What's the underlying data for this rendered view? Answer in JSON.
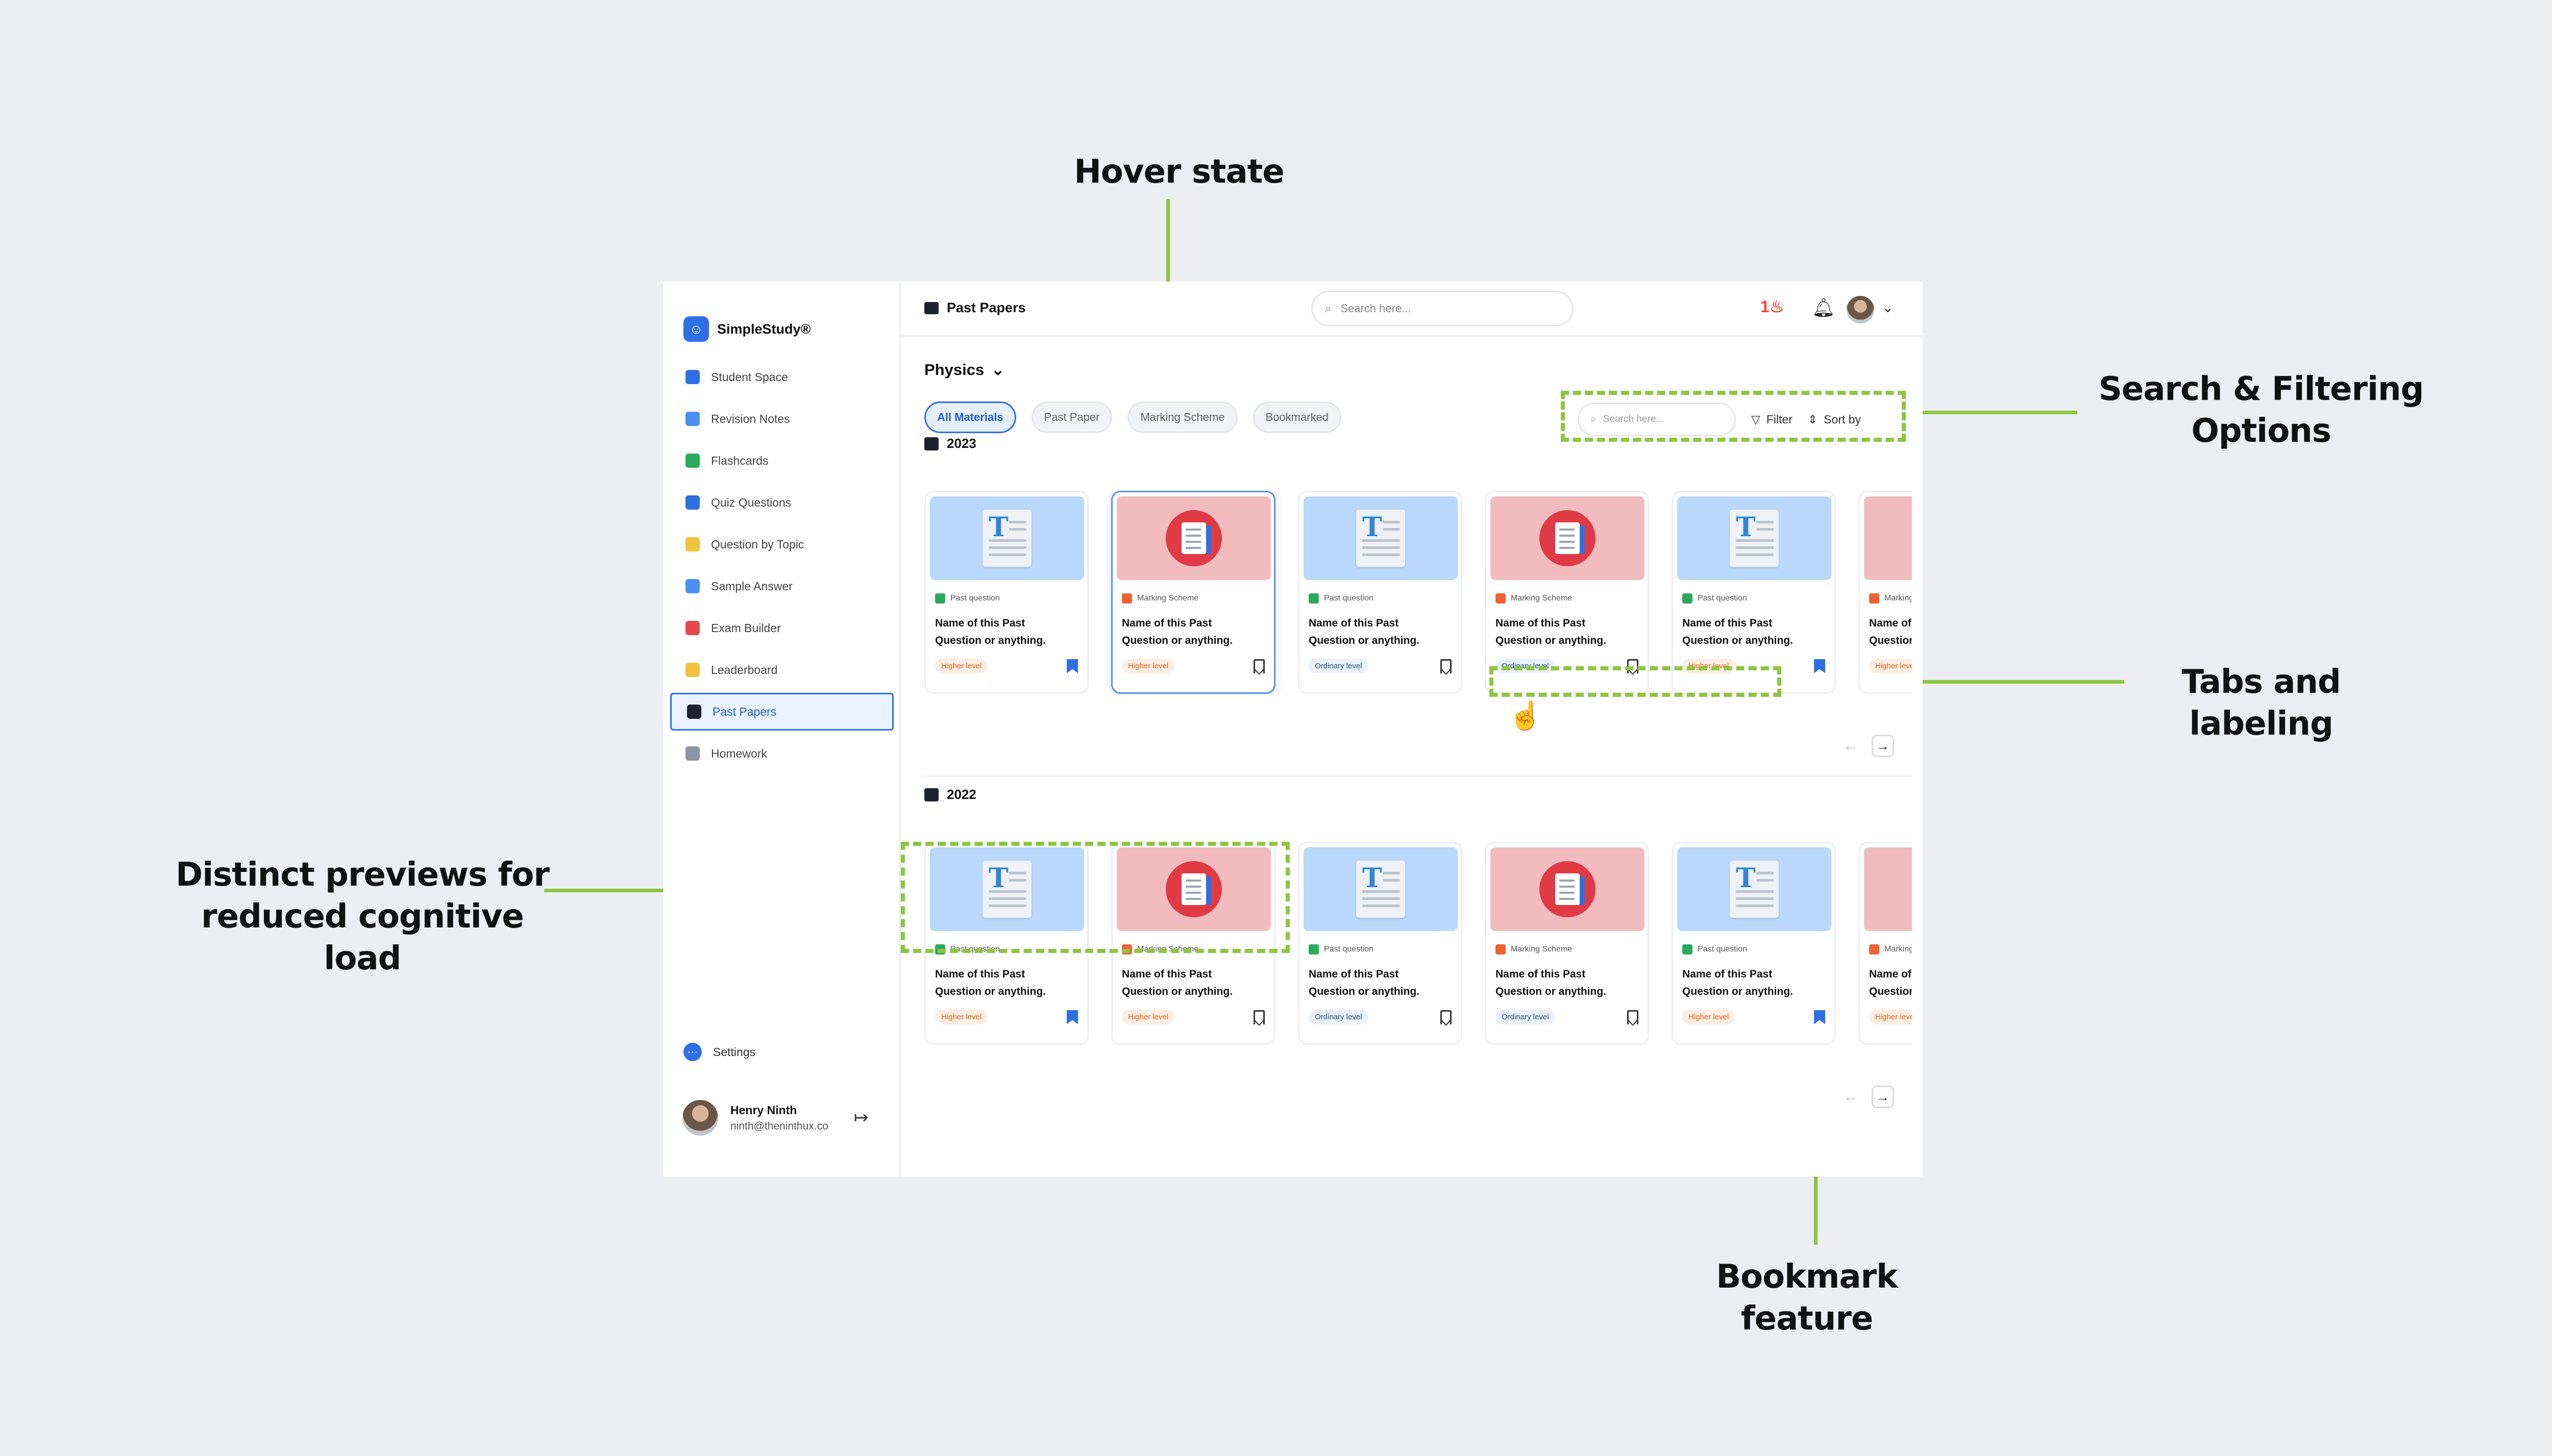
{
  "annotations": {
    "hover": "Hover state",
    "search_filter_line1": "Search & Filtering",
    "search_filter_line2": "Options",
    "tabs_labeling": "Tabs and labeling",
    "previews_line1": "Distinct previews for",
    "previews_line2": "reduced cognitive load",
    "bookmark": "Bookmark feature"
  },
  "brand": {
    "name": "SimpleStudy®",
    "accent": "#2f6fe4",
    "annotation_color": "#8cc63f"
  },
  "sidebar": {
    "items": [
      {
        "label": "Student Space",
        "icon": "graduation-icon",
        "color": "#2f6fe4"
      },
      {
        "label": "Revision Notes",
        "icon": "notes-icon",
        "color": "#4a8ff0"
      },
      {
        "label": "Flashcards",
        "icon": "flashcards-icon",
        "color": "#2aaa5c"
      },
      {
        "label": "Quiz Questions",
        "icon": "quiz-icon",
        "color": "#2f6fe4"
      },
      {
        "label": "Question by Topic",
        "icon": "topic-icon",
        "color": "#f3c23b"
      },
      {
        "label": "Sample Answer",
        "icon": "sample-answer-icon",
        "color": "#4a8ff0"
      },
      {
        "label": "Exam Builder",
        "icon": "exam-builder-icon",
        "color": "#e5484d"
      },
      {
        "label": "Leaderboard",
        "icon": "trophy-icon",
        "color": "#f3c23b"
      },
      {
        "label": "Past Papers",
        "icon": "past-papers-icon",
        "color": "#1c2230",
        "active": true
      },
      {
        "label": "Homework",
        "icon": "homework-icon",
        "color": "#8b94a3"
      }
    ],
    "settings": "Settings",
    "user": {
      "name": "Henry Ninth",
      "email": "ninth@theninthux.co"
    }
  },
  "topbar": {
    "title": "Past Papers",
    "search_placeholder": "Search here...",
    "streak": "1"
  },
  "subject": "Physics",
  "tabs": [
    "All Materials",
    "Past Paper",
    "Marking Scheme",
    "Bookmarked"
  ],
  "filter": {
    "search_placeholder": "Search here...",
    "filter_label": "Filter",
    "sort_label": "Sort by"
  },
  "sections": [
    {
      "year": "2023",
      "cards": [
        {
          "type": "Past question",
          "kind": "past",
          "name1": "Name of this Past",
          "name2": "Question or anything.",
          "level": "Higher level",
          "lvl": "h",
          "bookmarked": true
        },
        {
          "type": "Marking Scheme",
          "kind": "ms",
          "name1": "Name of this Past",
          "name2": "Question or anything.",
          "level": "Higher level",
          "lvl": "h",
          "bookmarked": false
        },
        {
          "type": "Past question",
          "kind": "past",
          "name1": "Name of this Past",
          "name2": "Question or anything.",
          "level": "Ordinary level",
          "lvl": "o",
          "bookmarked": false
        },
        {
          "type": "Marking Scheme",
          "kind": "ms",
          "name1": "Name of this Past",
          "name2": "Question or anything.",
          "level": "Ordinary level",
          "lvl": "o",
          "bookmarked": false
        },
        {
          "type": "Past question",
          "kind": "past",
          "name1": "Name of this Past",
          "name2": "Question or anything.",
          "level": "Higher level",
          "lvl": "h",
          "bookmarked": true
        },
        {
          "type": "Marking Scheme",
          "kind": "ms",
          "name1": "Name of this Past",
          "name2": "Question or anything.",
          "level": "Higher level",
          "lvl": "h",
          "bookmarked": false
        }
      ]
    },
    {
      "year": "2022",
      "cards": [
        {
          "type": "Past question",
          "kind": "past",
          "name1": "Name of this Past",
          "name2": "Question or anything.",
          "level": "Higher level",
          "lvl": "h",
          "bookmarked": true
        },
        {
          "type": "Marking Scheme",
          "kind": "ms",
          "name1": "Name of this Past",
          "name2": "Question or anything.",
          "level": "Higher level",
          "lvl": "h",
          "bookmarked": false
        },
        {
          "type": "Past question",
          "kind": "past",
          "name1": "Name of this Past",
          "name2": "Question or anything.",
          "level": "Ordinary level",
          "lvl": "o",
          "bookmarked": false
        },
        {
          "type": "Marking Scheme",
          "kind": "ms",
          "name1": "Name of this Past",
          "name2": "Question or anything.",
          "level": "Ordinary level",
          "lvl": "o",
          "bookmarked": false
        },
        {
          "type": "Past question",
          "kind": "past",
          "name1": "Name of this Past",
          "name2": "Question or anything.",
          "level": "Higher level",
          "lvl": "h",
          "bookmarked": true
        },
        {
          "type": "Marking Scheme",
          "kind": "ms",
          "name1": "Name of this Past",
          "name2": "Question or anything.",
          "level": "Higher level",
          "lvl": "h",
          "bookmarked": false
        }
      ]
    }
  ]
}
